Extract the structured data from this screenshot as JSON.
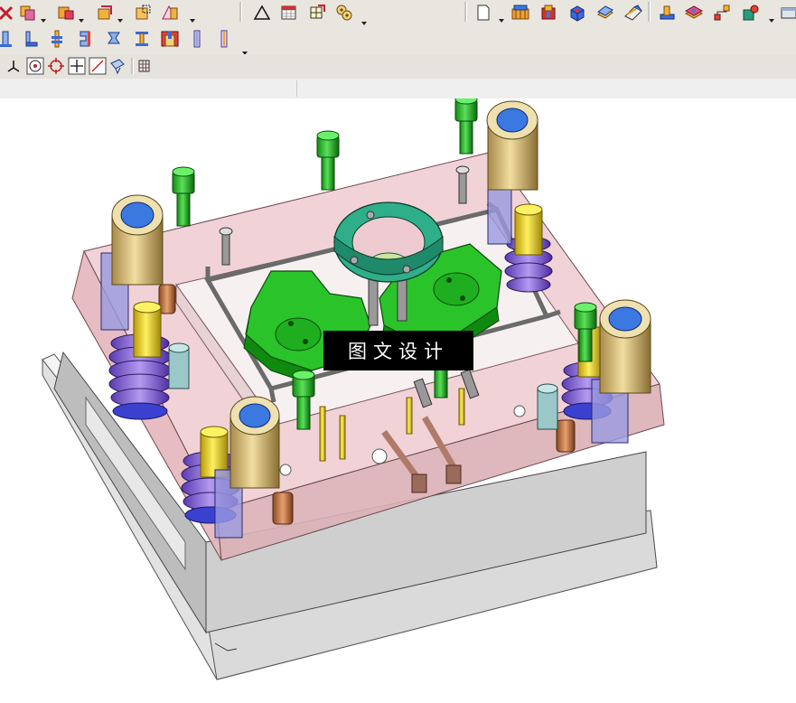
{
  "toolbar": {
    "row1_left": [
      {
        "icon": "delete-icon"
      },
      {
        "icon": "copy-body-icon"
      },
      {
        "icon": "boolean-body-icon"
      },
      {
        "icon": "body-transform-icon"
      },
      {
        "icon": "extract-body-icon"
      },
      {
        "icon": "draft-analysis-icon"
      }
    ],
    "row1_mid": [
      {
        "icon": "triangle-icon"
      },
      {
        "icon": "table-icon"
      },
      {
        "icon": "grid-edit-icon"
      },
      {
        "icon": "gear-parts-icon"
      }
    ],
    "row1_right": [
      {
        "icon": "new-document-icon"
      },
      {
        "icon": "mold-base-icon"
      },
      {
        "icon": "mold-wizard-icon"
      },
      {
        "icon": "block-icon"
      },
      {
        "icon": "surface-patch-icon"
      },
      {
        "icon": "parting-icon"
      },
      {
        "icon": "slide-icon"
      },
      {
        "icon": "cavity-layout-icon"
      },
      {
        "icon": "gate-icon"
      },
      {
        "icon": "insert-icon"
      },
      {
        "icon": "panel-icon"
      }
    ],
    "row2": [
      {
        "icon": "pin-up-icon"
      },
      {
        "icon": "pin-side-icon"
      },
      {
        "icon": "ejector-pin-icon"
      },
      {
        "icon": "sleeve-icon"
      },
      {
        "icon": "support-icon"
      },
      {
        "icon": "stop-pin-icon"
      },
      {
        "icon": "cooling-icon"
      },
      {
        "icon": "bore-icon"
      },
      {
        "icon": "bore-line-icon"
      }
    ],
    "row3": [
      {
        "icon": "datum-plane-icon"
      },
      {
        "icon": "point-circle-icon"
      },
      {
        "icon": "target-icon"
      },
      {
        "icon": "crosshair-icon"
      },
      {
        "icon": "line-tool-icon"
      },
      {
        "icon": "face-select-icon"
      },
      {
        "icon": "mesh-icon"
      }
    ]
  },
  "colors": {
    "toolbar_bg": "#e9e6df",
    "plate_pink": "#e8c4c8",
    "plate_grey": "#cfcfcf",
    "green_part": "#22b422",
    "teal_ring": "#2fae8a",
    "guide_bushing": "#d9c08a",
    "blue_bore": "#3b78e0",
    "purple_spring": "#8c6ad6",
    "yellow_pin": "#e8d31a"
  },
  "watermark": {
    "text": "图文设计"
  }
}
